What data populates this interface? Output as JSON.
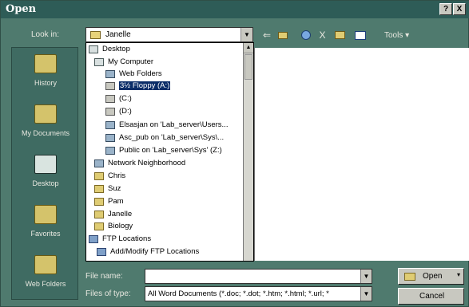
{
  "window": {
    "title": "Open",
    "help_label": "?",
    "close_label": "X"
  },
  "lookin": {
    "label": "Look in:",
    "value": "Janelle",
    "drop_glyph": "▼"
  },
  "toolbar": {
    "back_glyph": "⇐",
    "delete_glyph": "X",
    "tools_label": "Tools ▾"
  },
  "places": [
    {
      "label": "History",
      "icon": "history-icon"
    },
    {
      "label": "My Documents",
      "icon": "my-documents-icon"
    },
    {
      "label": "Desktop",
      "icon": "desktop-icon"
    },
    {
      "label": "Favorites",
      "icon": "favorites-icon"
    },
    {
      "label": "Web Folders",
      "icon": "web-folders-icon"
    }
  ],
  "tree": [
    {
      "label": "Desktop",
      "icon": "desktop-icon"
    },
    {
      "label": "My Computer",
      "icon": "my-computer-icon"
    },
    {
      "label": "Web Folders",
      "icon": "web-folders-icon"
    },
    {
      "label": "3½ Floppy (A:)",
      "icon": "floppy-icon"
    },
    {
      "label": "(C:)",
      "icon": "drive-icon"
    },
    {
      "label": "(D:)",
      "icon": "drive-icon"
    },
    {
      "label": "Elsasjan on 'Lab_server\\Users...",
      "icon": "network-drive-icon"
    },
    {
      "label": "Asc_pub on 'Lab_server\\Sys\\...",
      "icon": "network-drive-icon"
    },
    {
      "label": "Public on 'Lab_server\\Sys' (Z:)",
      "icon": "network-drive-icon"
    },
    {
      "label": "Network Neighborhood",
      "icon": "network-icon"
    },
    {
      "label": "Chris",
      "icon": "folder-icon"
    },
    {
      "label": "Suz",
      "icon": "folder-icon"
    },
    {
      "label": "Pam",
      "icon": "folder-icon"
    },
    {
      "label": "Janelle",
      "icon": "folder-icon"
    },
    {
      "label": "Biology",
      "icon": "folder-icon"
    },
    {
      "label": "FTP Locations",
      "icon": "ftp-icon"
    },
    {
      "label": "Add/Modify FTP Locations",
      "icon": "ftp-icon"
    }
  ],
  "selected_tree_item": "3½ Floppy (A:)",
  "file_name": {
    "label": "File name:",
    "value": ""
  },
  "files_of_type": {
    "label": "Files of type:",
    "value": "All Word Documents (*.doc; *.dot; *.htm; *.html; *.url; *"
  },
  "buttons": {
    "open": "Open",
    "cancel": "Cancel",
    "split_glyph": "▾"
  },
  "colors": {
    "background": "#4f7a6e",
    "titlebar": "#2e5c57",
    "selection": "#0b2d68"
  }
}
